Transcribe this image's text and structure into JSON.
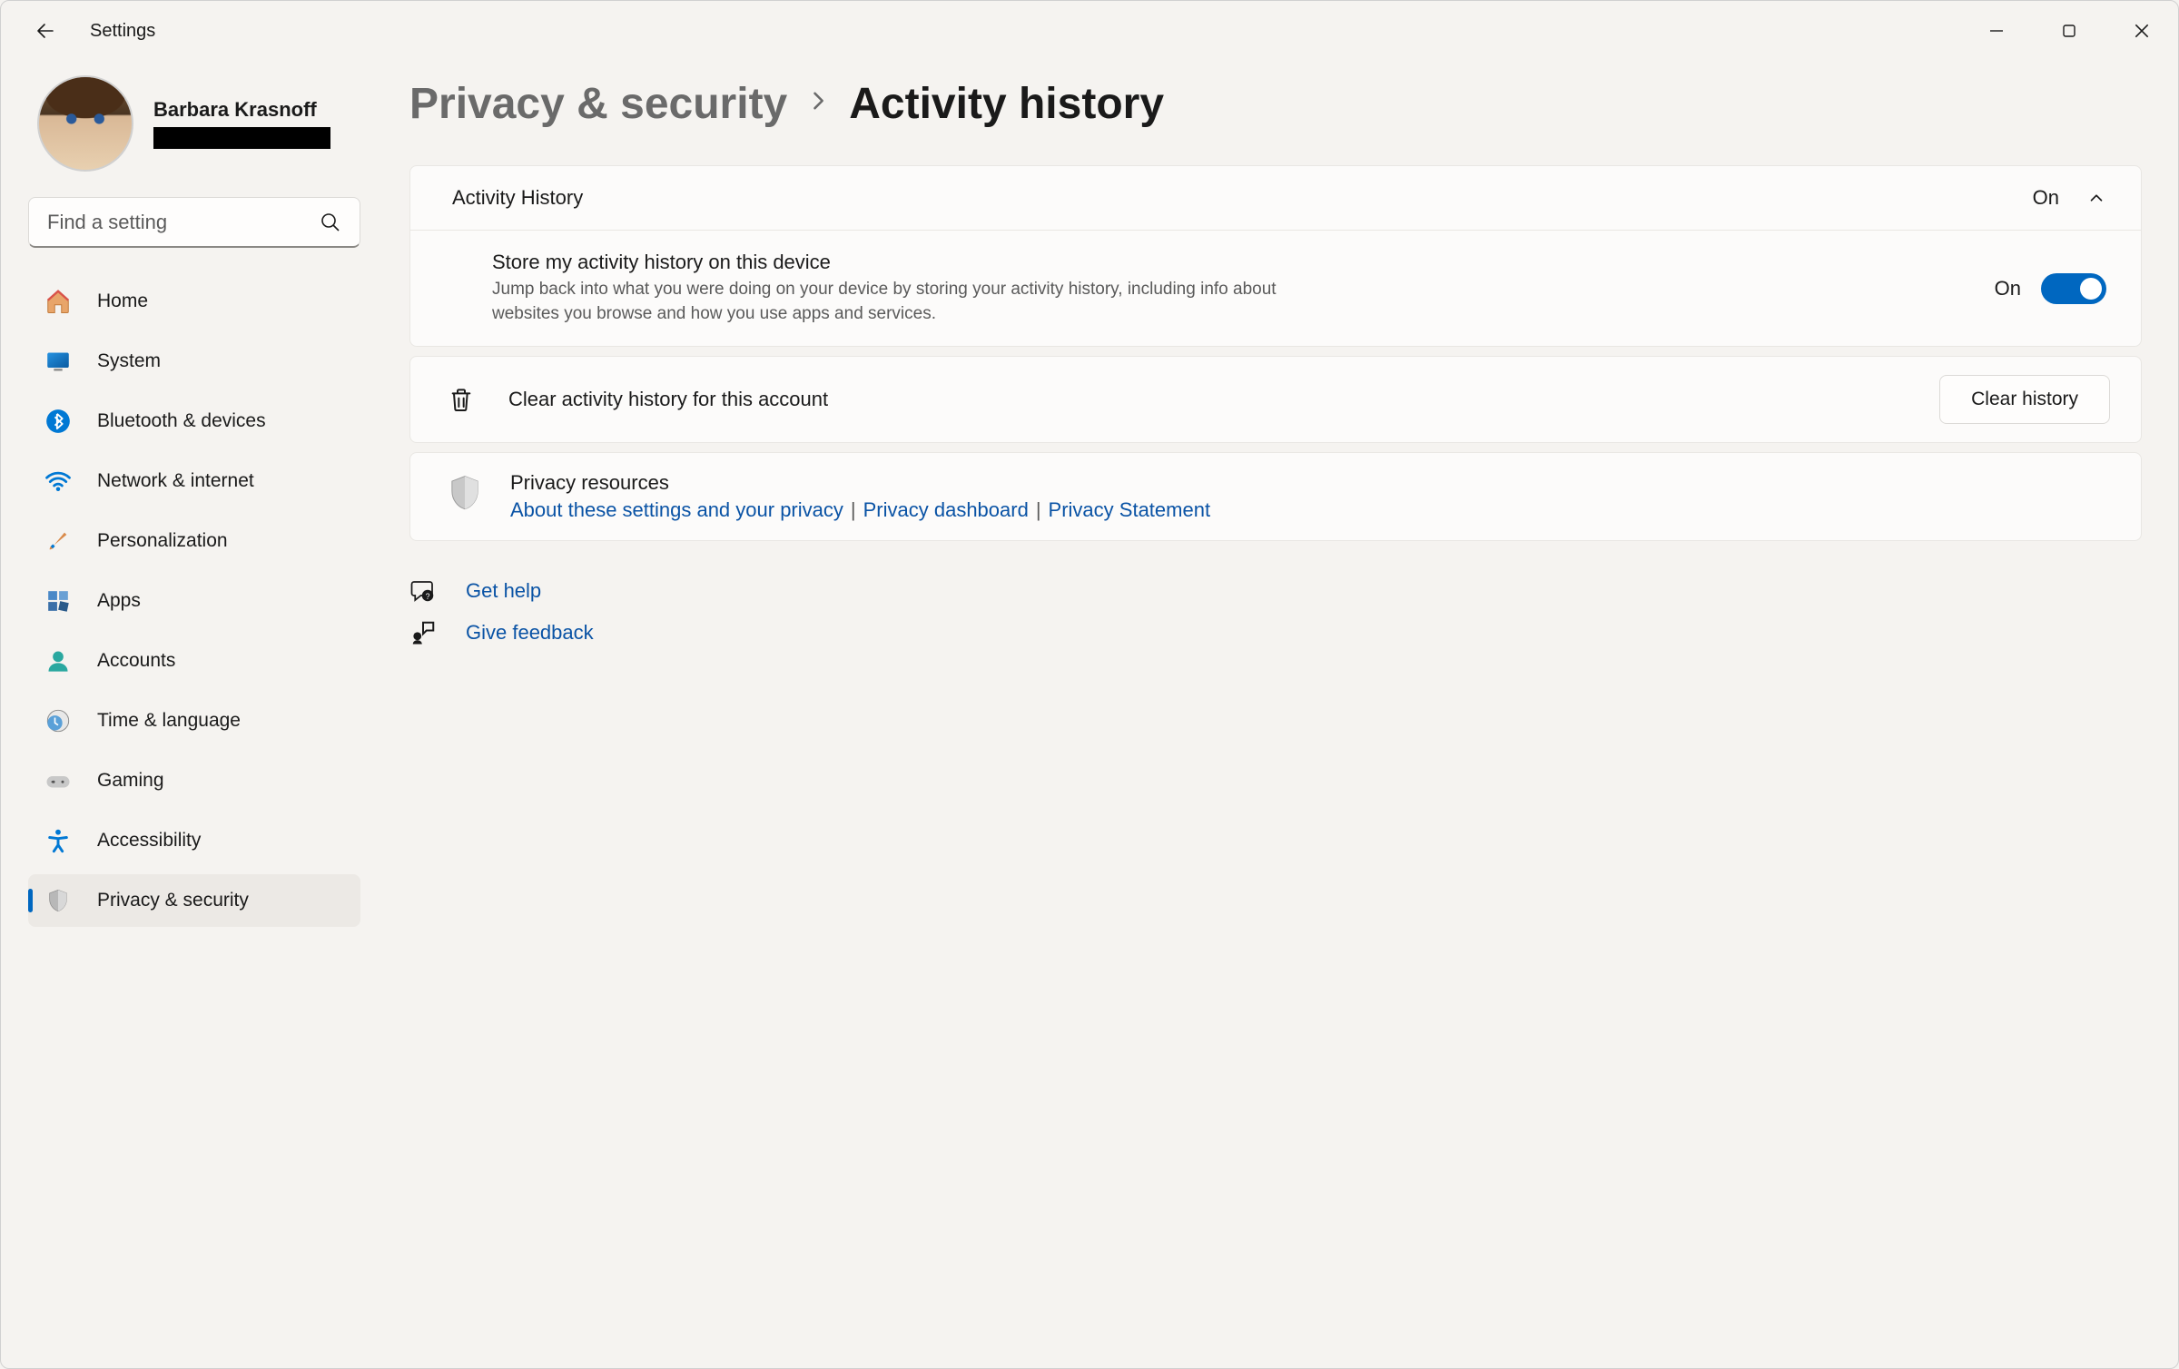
{
  "app_title": "Settings",
  "profile": {
    "name": "Barbara Krasnoff"
  },
  "search": {
    "placeholder": "Find a setting"
  },
  "nav": {
    "items": [
      {
        "label": "Home",
        "key": "home"
      },
      {
        "label": "System",
        "key": "system"
      },
      {
        "label": "Bluetooth & devices",
        "key": "bluetooth"
      },
      {
        "label": "Network & internet",
        "key": "network"
      },
      {
        "label": "Personalization",
        "key": "personalization"
      },
      {
        "label": "Apps",
        "key": "apps"
      },
      {
        "label": "Accounts",
        "key": "accounts"
      },
      {
        "label": "Time & language",
        "key": "time"
      },
      {
        "label": "Gaming",
        "key": "gaming"
      },
      {
        "label": "Accessibility",
        "key": "accessibility"
      },
      {
        "label": "Privacy & security",
        "key": "privacy"
      }
    ]
  },
  "breadcrumb": {
    "parent": "Privacy & security",
    "current": "Activity history"
  },
  "activity": {
    "header_label": "Activity History",
    "header_status": "On",
    "store_title": "Store my activity history on this device",
    "store_desc": "Jump back into what you were doing on your device by storing your activity history, including info about websites you browse and how you use apps and services.",
    "store_toggle_label": "On"
  },
  "clear": {
    "label": "Clear activity history for this account",
    "button": "Clear history"
  },
  "privacy_resources": {
    "title": "Privacy resources",
    "link1": "About these settings and your privacy",
    "link2": "Privacy dashboard",
    "link3": "Privacy Statement"
  },
  "help": {
    "get_help": "Get help",
    "give_feedback": "Give feedback"
  }
}
